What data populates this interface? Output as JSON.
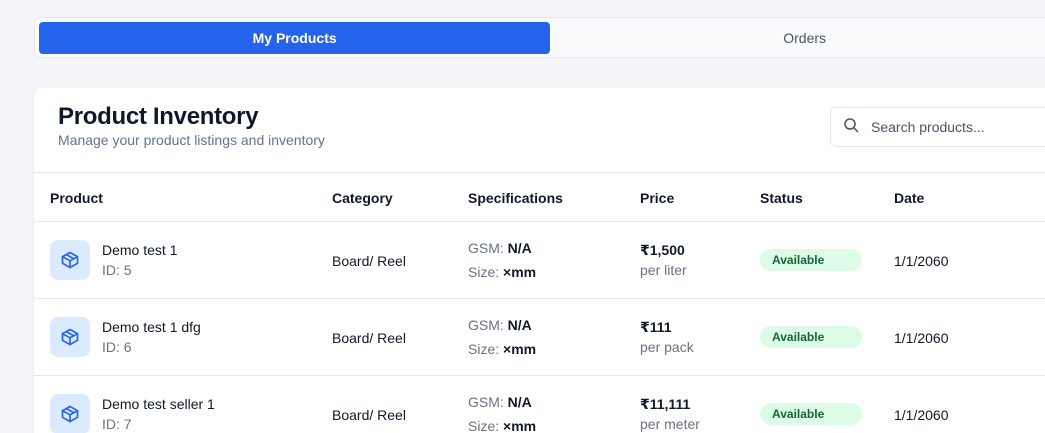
{
  "tabs": [
    {
      "label": "My Products",
      "active": true
    },
    {
      "label": "Orders",
      "active": false
    }
  ],
  "header": {
    "title": "Product Inventory",
    "subtitle": "Manage your product listings and inventory"
  },
  "search": {
    "placeholder": "Search products...",
    "icon": "search-icon"
  },
  "table": {
    "columns": [
      "Product",
      "Category",
      "Specifications",
      "Price",
      "Status",
      "Date"
    ],
    "spec_labels": {
      "gsm": "GSM:",
      "size": "Size:"
    },
    "rows": [
      {
        "name": "Demo test 1",
        "id": "ID: 5",
        "category": "Board/ Reel",
        "gsm": "N/A",
        "size": "×mm",
        "price": "₹1,500",
        "unit": "per liter",
        "status": "Available",
        "date": "1/1/2060"
      },
      {
        "name": "Demo test 1 dfg",
        "id": "ID: 6",
        "category": "Board/ Reel",
        "gsm": "N/A",
        "size": "×mm",
        "price": "₹111",
        "unit": "per pack",
        "status": "Available",
        "date": "1/1/2060"
      },
      {
        "name": "Demo test seller 1",
        "id": "ID: 7",
        "category": "Board/ Reel",
        "gsm": "N/A",
        "size": "×mm",
        "price": "₹11,111",
        "unit": "per meter",
        "status": "Available",
        "date": "1/1/2060"
      }
    ]
  },
  "colors": {
    "accent": "#2563eb",
    "status_bg": "#dcfce7",
    "status_text": "#166534",
    "icon_bg": "#dbeafe"
  }
}
